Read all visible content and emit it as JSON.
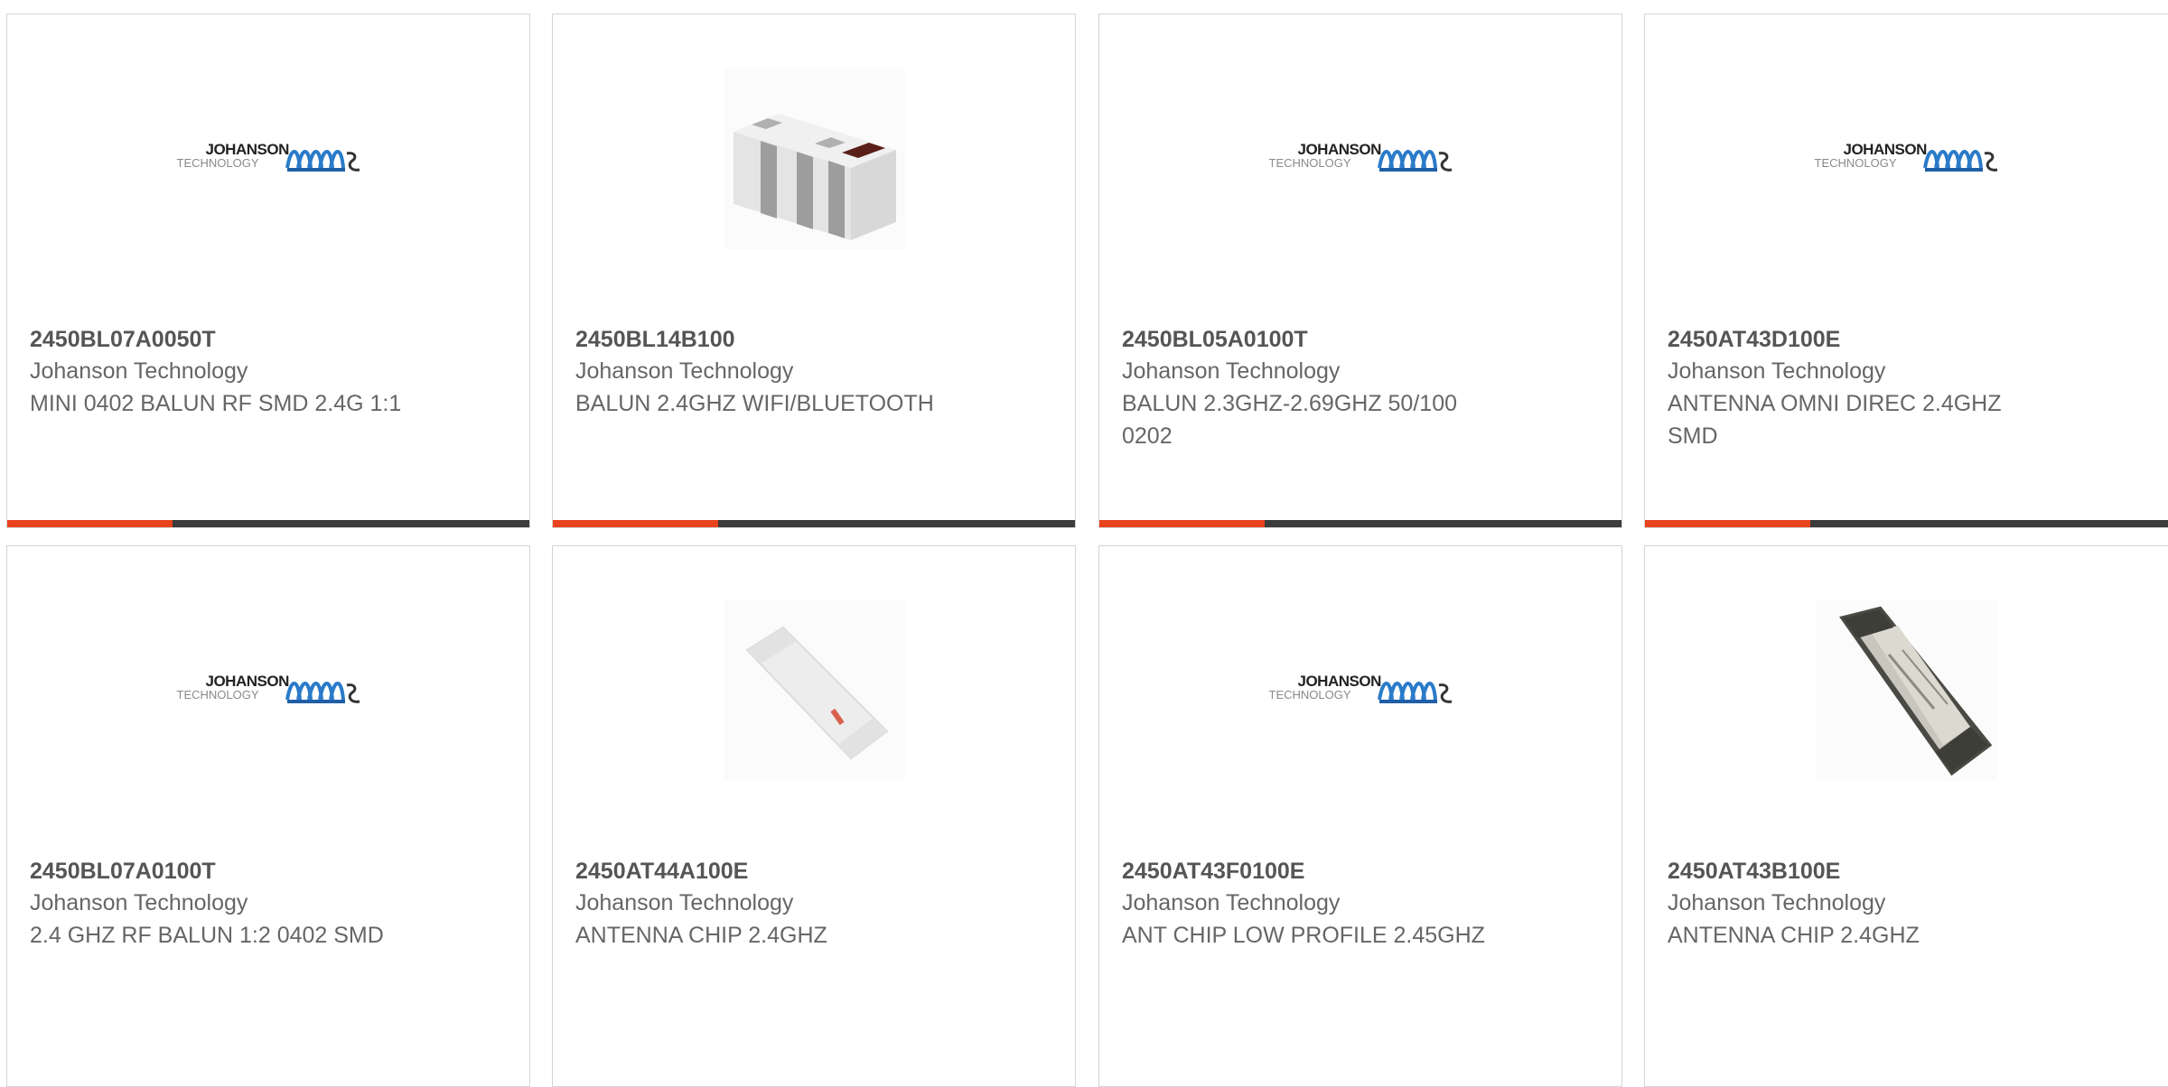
{
  "products": [
    {
      "part_number": "2450BL07A0050T",
      "manufacturer": "Johanson Technology",
      "description": "MINI 0402 BALUN RF SMD 2.4G 1:1",
      "image": "johanson-logo"
    },
    {
      "part_number": "2450BL14B100",
      "manufacturer": "Johanson Technology",
      "description": "BALUN 2.4GHZ WIFI/BLUETOOTH",
      "image": "balun-component-photo"
    },
    {
      "part_number": "2450BL05A0100T",
      "manufacturer": "Johanson Technology",
      "description": "BALUN 2.3GHZ-2.69GHZ 50/100 0202",
      "image": "johanson-logo"
    },
    {
      "part_number": "2450AT43D100E",
      "manufacturer": "Johanson Technology",
      "description": "ANTENNA OMNI DIREC 2.4GHZ SMD",
      "image": "johanson-logo"
    },
    {
      "part_number": "2450BL07A0100T",
      "manufacturer": "Johanson Technology",
      "description": "2.4 GHZ RF BALUN 1:2 0402 SMD",
      "image": "johanson-logo"
    },
    {
      "part_number": "2450AT44A100E",
      "manufacturer": "Johanson Technology",
      "description": "ANTENNA CHIP 2.4GHZ",
      "image": "chip-antenna-photo"
    },
    {
      "part_number": "2450AT43F0100E",
      "manufacturer": "Johanson Technology",
      "description": "ANT CHIP LOW PROFILE 2.45GHZ",
      "image": "johanson-logo"
    },
    {
      "part_number": "2450AT43B100E",
      "manufacturer": "Johanson Technology",
      "description": "ANTENNA CHIP 2.4GHZ",
      "image": "dark-chip-antenna-photo"
    }
  ],
  "logo": {
    "line1": "JOHANSON",
    "line2": "TECHNOLOGY"
  },
  "colors": {
    "accent": "#e8431d",
    "bar": "#3c3c3c",
    "border": "#d4d4d4",
    "text": "#666666"
  }
}
